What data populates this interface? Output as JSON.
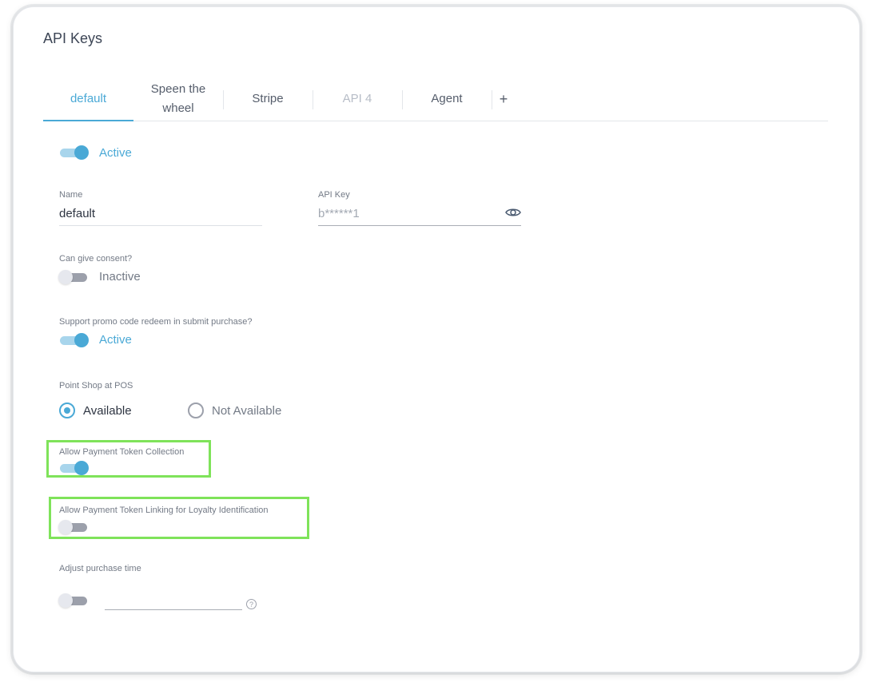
{
  "page": {
    "title": "API Keys"
  },
  "tabs": [
    {
      "label_line1": "default",
      "label_line2": "",
      "state": "active"
    },
    {
      "label_line1": "Speen the",
      "label_line2": "wheel",
      "state": "normal"
    },
    {
      "label_line1": "Stripe",
      "label_line2": "",
      "state": "normal"
    },
    {
      "label_line1": "API 4",
      "label_line2": "",
      "state": "disabled"
    },
    {
      "label_line1": "Agent",
      "label_line2": "",
      "state": "normal"
    }
  ],
  "add_tab": {
    "icon": "plus-icon",
    "label": "+"
  },
  "active_toggle": {
    "on": true,
    "state_label": "Active"
  },
  "name_field": {
    "label": "Name",
    "value": "default"
  },
  "api_key_field": {
    "label": "API Key",
    "value": "b******1",
    "icon": "eye-icon"
  },
  "consent": {
    "label": "Can give consent?",
    "on": false,
    "state_label": "Inactive"
  },
  "promo": {
    "label": "Support promo code redeem in submit purchase?",
    "on": true,
    "state_label": "Active"
  },
  "point_shop": {
    "label": "Point Shop at POS",
    "options": [
      {
        "label": "Available",
        "selected": true
      },
      {
        "label": "Not Available",
        "selected": false
      }
    ]
  },
  "payment_token_collection": {
    "label": "Allow Payment Token Collection",
    "on": true
  },
  "payment_token_linking": {
    "label": "Allow Payment Token Linking for Loyalty Identification",
    "on": false
  },
  "adjust_purchase_time": {
    "label": "Adjust purchase time",
    "on": false,
    "value": "",
    "help_icon": "help-icon",
    "help_glyph": "?"
  },
  "colors": {
    "accent": "#4aa9d6",
    "highlight": "#7fe35a",
    "text": "#2e3542",
    "muted": "#737a86"
  }
}
